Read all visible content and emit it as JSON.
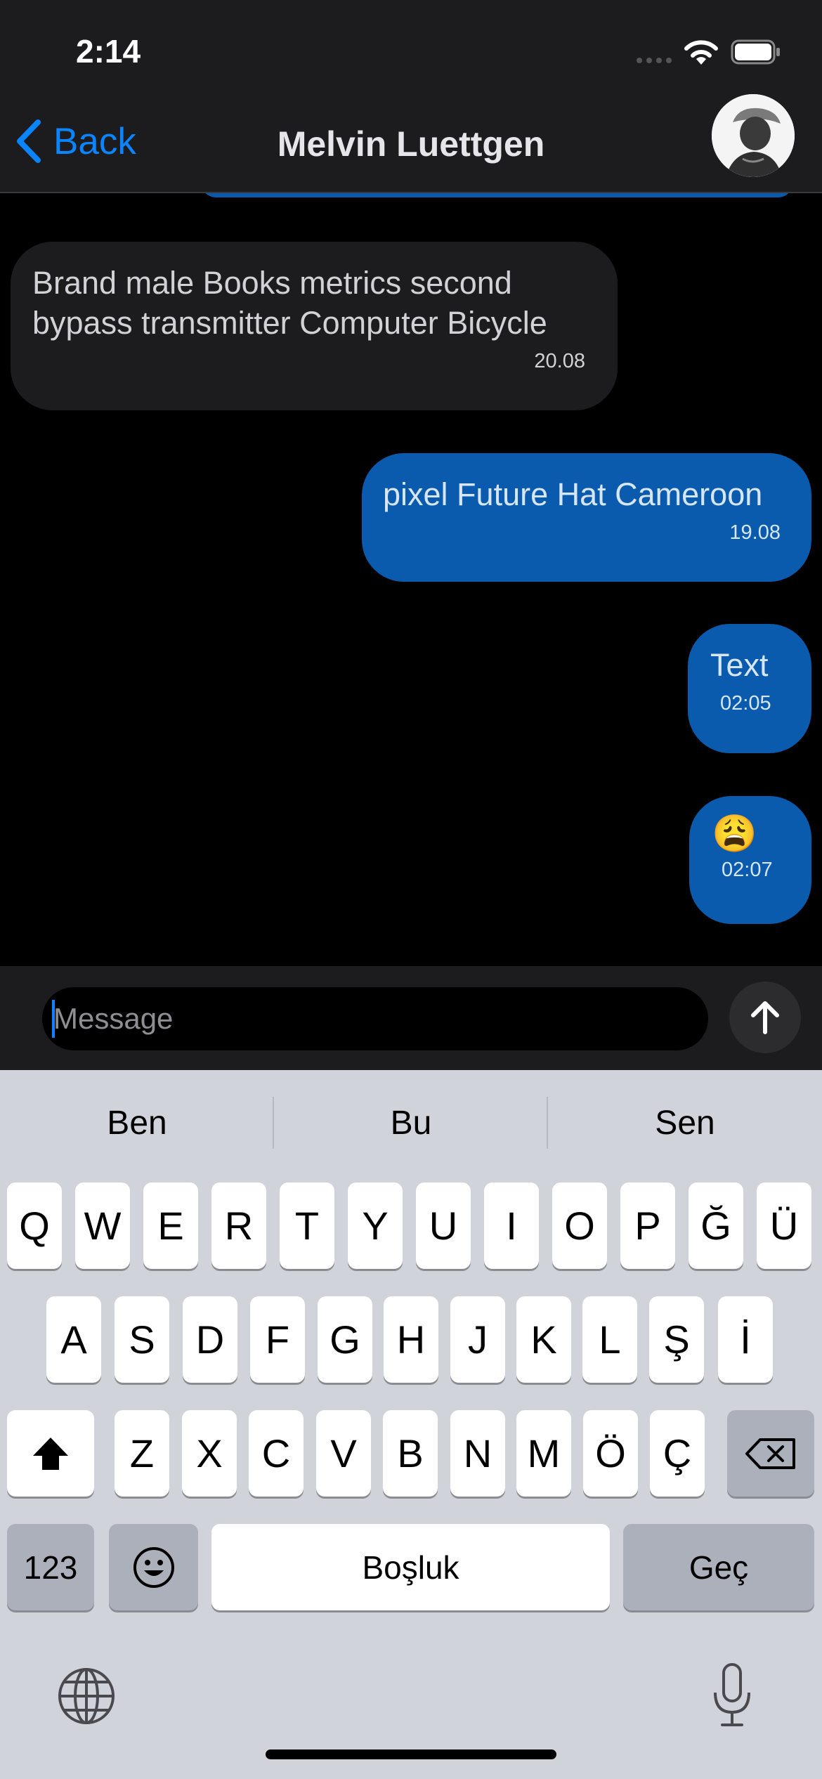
{
  "status_bar": {
    "time": "2:14"
  },
  "nav": {
    "back_label": "Back",
    "title": "Melvin Luettgen"
  },
  "messages": [
    {
      "direction": "incoming",
      "text": "Brand male Books metrics second bypass transmitter Computer Bicycle",
      "time": "20.08"
    },
    {
      "direction": "outgoing",
      "text": "pixel Future Hat Cameroon",
      "time": "19.08"
    },
    {
      "direction": "outgoing",
      "text": "Text",
      "time": "02:05"
    },
    {
      "direction": "outgoing",
      "text": "😩",
      "time": "02:07"
    }
  ],
  "composer": {
    "placeholder": "Message",
    "value": ""
  },
  "keyboard": {
    "suggestions": [
      "Ben",
      "Bu",
      "Sen"
    ],
    "row1": [
      "Q",
      "W",
      "E",
      "R",
      "T",
      "Y",
      "U",
      "I",
      "O",
      "P",
      "Ğ",
      "Ü"
    ],
    "row2": [
      "A",
      "S",
      "D",
      "F",
      "G",
      "H",
      "J",
      "K",
      "L",
      "Ş",
      "İ"
    ],
    "row3": [
      "Z",
      "X",
      "C",
      "V",
      "B",
      "N",
      "M",
      "Ö",
      "Ç"
    ],
    "numbers_label": "123",
    "space_label": "Boşluk",
    "return_label": "Geç"
  },
  "colors": {
    "accent": "#0a84ff",
    "outgoing_bubble": "#0a5bad",
    "incoming_bubble": "#1c1c1e"
  }
}
